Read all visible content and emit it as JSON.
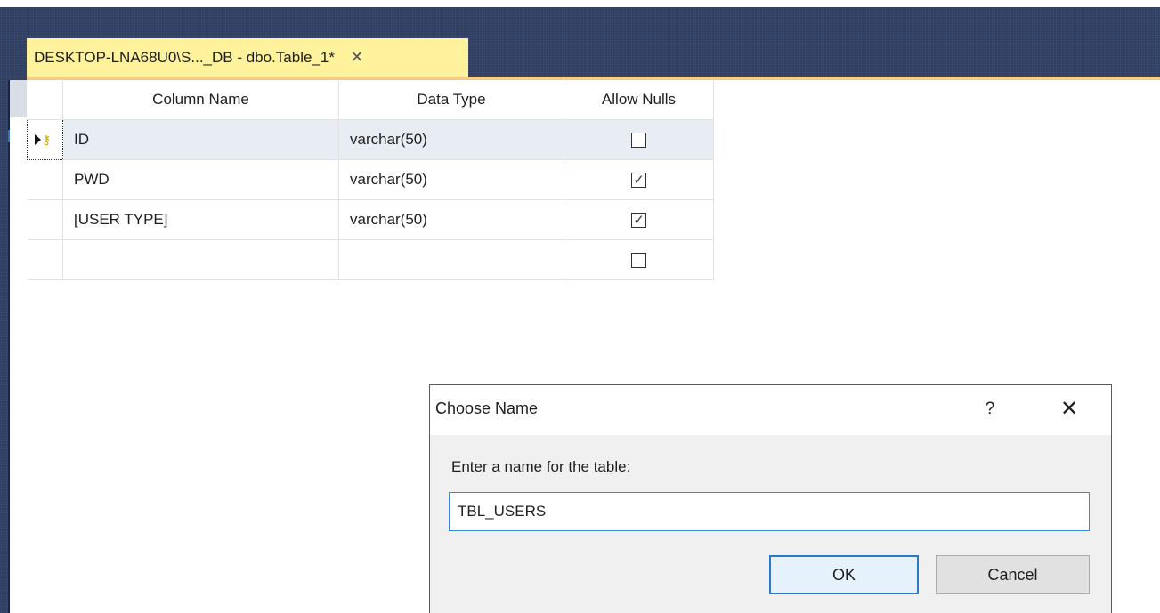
{
  "tab": {
    "title": "DESKTOP-LNA68U0\\S..._DB - dbo.Table_1*",
    "close_glyph": "✕"
  },
  "grid": {
    "headers": [
      "Column Name",
      "Data Type",
      "Allow Nulls"
    ],
    "rows": [
      {
        "name": "ID",
        "type": "varchar(50)",
        "allow_nulls": false,
        "active": true,
        "primary_key": true
      },
      {
        "name": "PWD",
        "type": "varchar(50)",
        "allow_nulls": true
      },
      {
        "name": "[USER TYPE]",
        "type": "varchar(50)",
        "allow_nulls": true
      },
      {
        "name": "",
        "type": "",
        "allow_nulls": false
      }
    ]
  },
  "dialog": {
    "title": "Choose Name",
    "help_label": "?",
    "close_label": "✕",
    "prompt": "Enter a name for the table:",
    "input_value": "TBL_USERS",
    "ok_label": "OK",
    "cancel_label": "Cancel"
  },
  "colors": {
    "tab_active": "#fff29d",
    "title_bar": "#2b3a60",
    "accent": "#f5cc84",
    "selected_row": "#e8ecf3",
    "ok_border": "#2b78c4"
  },
  "icons": {
    "row_marker": "arrow-key-icon"
  }
}
